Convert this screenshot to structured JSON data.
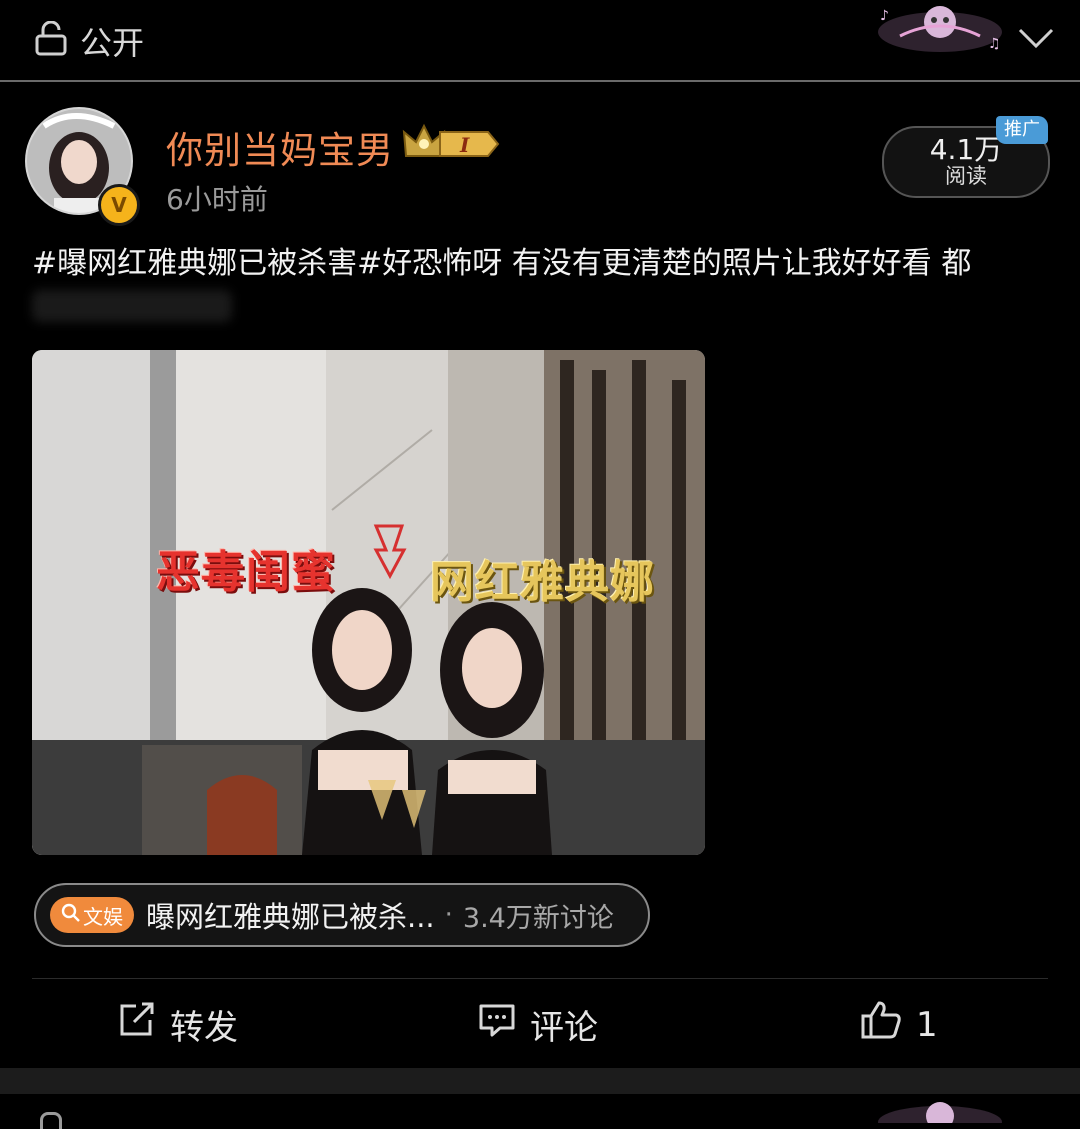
{
  "visibility": {
    "label": "公开",
    "icon": "unlock-icon"
  },
  "post": {
    "username": "你别当妈宝男",
    "time": "6小时前",
    "reads": {
      "count": "4.1万",
      "label": "阅读"
    },
    "promo_badge": "推广",
    "text": "#曝网红雅典娜已被杀害#好恐怖呀 有没有更清楚的照片让我好好看 都",
    "image_labels": {
      "left": "恶毒闺蜜",
      "right": "网红雅典娜"
    }
  },
  "topic": {
    "tag": "文娱",
    "title": "曝网红雅典娜已被杀...",
    "dot": "·",
    "count": "3.4万新讨论"
  },
  "actions": {
    "forward": "转发",
    "comment": "评论",
    "like_count": "1"
  },
  "colors": {
    "username": "#f08a55",
    "promo": "#4a9bd7",
    "topic_tag": "#f08a3c",
    "verified": "#f5b31b"
  }
}
